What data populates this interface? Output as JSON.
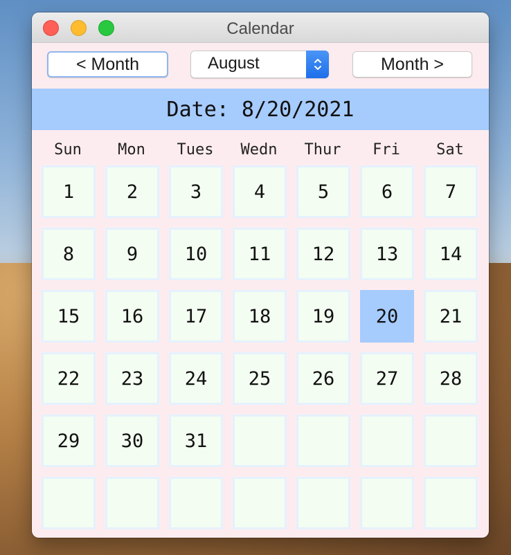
{
  "window": {
    "title": "Calendar"
  },
  "controls": {
    "prev_label": "< Month",
    "next_label": "Month >",
    "month_select": {
      "value": "August"
    }
  },
  "banner": {
    "text": "Date: 8/20/2021"
  },
  "weekdays": [
    "Sun",
    "Mon",
    "Tues",
    "Wedn",
    "Thur",
    "Fri",
    "Sat"
  ],
  "grid": {
    "rows": [
      [
        "1",
        "2",
        "3",
        "4",
        "5",
        "6",
        "7"
      ],
      [
        "8",
        "9",
        "10",
        "11",
        "12",
        "13",
        "14"
      ],
      [
        "15",
        "16",
        "17",
        "18",
        "19",
        "20",
        "21"
      ],
      [
        "22",
        "23",
        "24",
        "25",
        "26",
        "27",
        "28"
      ],
      [
        "29",
        "30",
        "31",
        "",
        "",
        "",
        ""
      ],
      [
        "",
        "",
        "",
        "",
        "",
        "",
        ""
      ]
    ],
    "selected_day": "20"
  },
  "colors": {
    "window_bg": "#fdecef",
    "cell_bg": "#f3fdf1",
    "cell_border": "#e5f1fd",
    "selected_bg": "#a6cbfd",
    "banner_bg": "#a6cbfd"
  }
}
